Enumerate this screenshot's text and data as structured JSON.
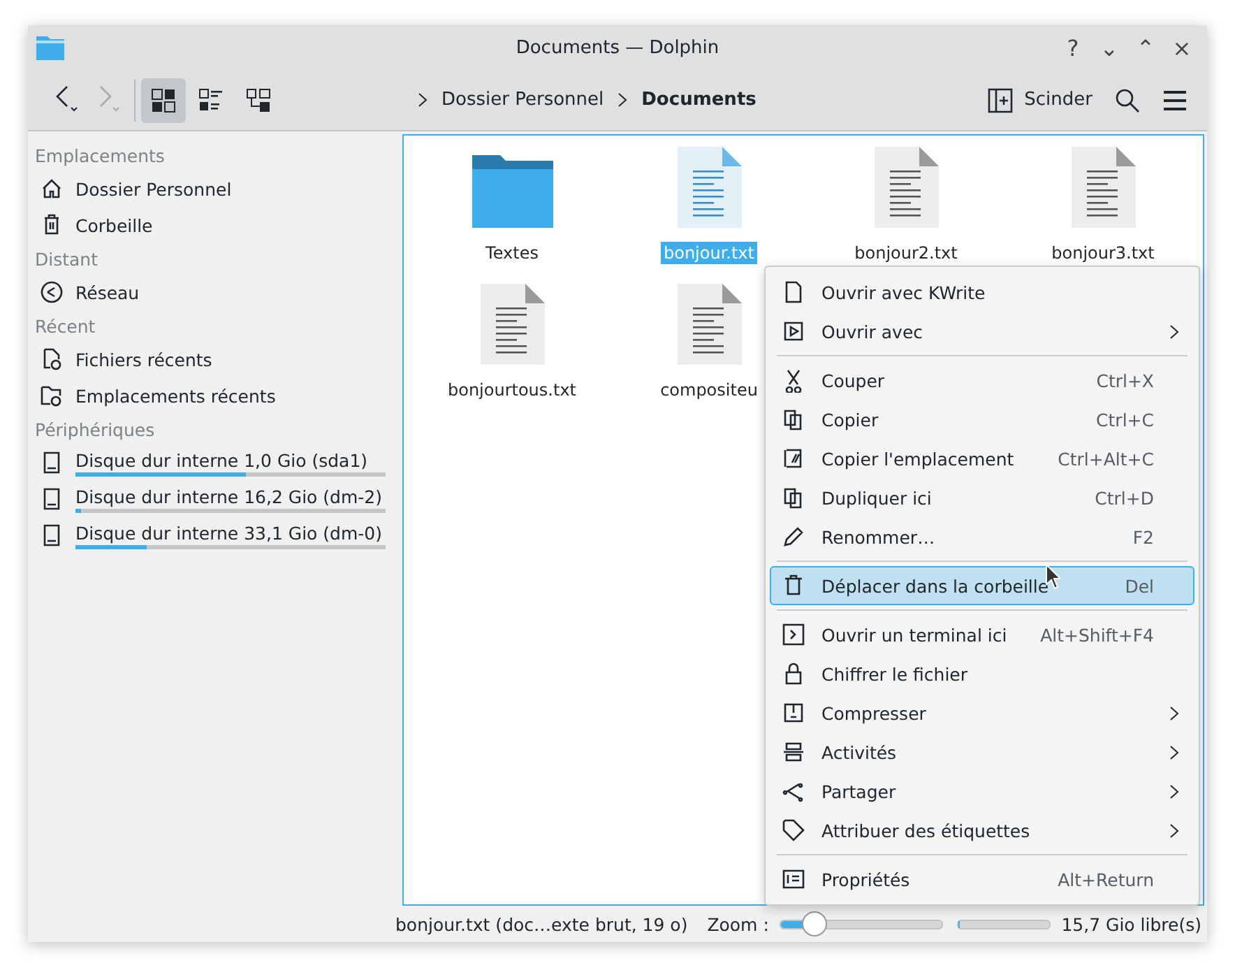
{
  "window": {
    "title": "Documents — Dolphin",
    "buttons": [
      "?",
      "⌄",
      "⌃",
      "×"
    ]
  },
  "toolbar": {
    "nav": [
      {
        "disabled": false
      },
      {
        "disabled": true
      }
    ],
    "views": [
      {
        "selected": true
      },
      {
        "selected": false
      },
      {
        "selected": false
      }
    ],
    "breadcrumb": [
      {
        "label": "Dossier Personnel",
        "current": false
      },
      {
        "label": "Documents",
        "current": true
      }
    ],
    "split_label": "Scinder"
  },
  "sidebar": [
    {
      "heading": "Emplacements",
      "items": [
        {
          "label": "Dossier Personnel"
        },
        {
          "label": "Corbeille"
        }
      ]
    },
    {
      "heading": "Distant",
      "items": [
        {
          "label": "Réseau"
        }
      ]
    },
    {
      "heading": "Récent",
      "items": [
        {
          "label": "Fichiers récents"
        },
        {
          "label": "Emplacements récents"
        }
      ]
    },
    {
      "heading": "Périphériques",
      "items": [
        {
          "label": "Disque dur interne 1,0 Gio (sda1)",
          "level": 0.55
        },
        {
          "label": "Disque dur interne 16,2 Gio (dm-2)",
          "level": 0.02
        },
        {
          "label": "Disque dur interne 33,1 Gio (dm-0)",
          "level": 0.23
        }
      ]
    }
  ],
  "files": [
    {
      "name": "Textes",
      "kind": "folder",
      "selected": false
    },
    {
      "name": "bonjour.txt",
      "kind": "text",
      "selected": true
    },
    {
      "name": "bonjour2.txt",
      "kind": "text",
      "selected": false
    },
    {
      "name": "bonjour3.txt",
      "kind": "text",
      "selected": false
    },
    {
      "name": "bonjourtous.txt",
      "kind": "text",
      "selected": false
    },
    {
      "name": "compositeu",
      "kind": "text",
      "selected": false
    }
  ],
  "context_menu": [
    {
      "kind": "item",
      "label": "Ouvrir avec KWrite",
      "selected": false
    },
    {
      "kind": "item",
      "label": "Ouvrir avec",
      "submenu": true,
      "selected": false
    },
    {
      "kind": "separator"
    },
    {
      "kind": "item",
      "label": "Couper",
      "shortcut": "Ctrl+X",
      "selected": false
    },
    {
      "kind": "item",
      "label": "Copier",
      "shortcut": "Ctrl+C",
      "selected": false
    },
    {
      "kind": "item",
      "label": "Copier l'emplacement",
      "shortcut": "Ctrl+Alt+C",
      "selected": false
    },
    {
      "kind": "item",
      "label": "Dupliquer ici",
      "shortcut": "Ctrl+D",
      "selected": false
    },
    {
      "kind": "item",
      "label": "Renommer…",
      "shortcut": "F2",
      "selected": false
    },
    {
      "kind": "separator"
    },
    {
      "kind": "item",
      "label": "Déplacer dans la corbeille",
      "shortcut": "Del",
      "selected": true
    },
    {
      "kind": "separator"
    },
    {
      "kind": "item",
      "label": "Ouvrir un terminal ici",
      "shortcut": "Alt+Shift+F4",
      "selected": false
    },
    {
      "kind": "item",
      "label": "Chiffrer le fichier",
      "selected": false
    },
    {
      "kind": "item",
      "label": "Compresser",
      "submenu": true,
      "selected": false
    },
    {
      "kind": "item",
      "label": "Activités",
      "submenu": true,
      "selected": false
    },
    {
      "kind": "item",
      "label": "Partager",
      "submenu": true,
      "selected": false
    },
    {
      "kind": "item",
      "label": "Attribuer des étiquettes",
      "submenu": true,
      "selected": false
    },
    {
      "kind": "separator"
    },
    {
      "kind": "item",
      "label": "Propriétés",
      "shortcut": "Alt+Return",
      "selected": false
    }
  ],
  "status_bar": {
    "text": "bonjour.txt (doc…exte brut, 19 o)",
    "zoom_label": "Zoom :",
    "zoom": {
      "level": 0.2
    },
    "space": {
      "level": 0.01
    },
    "free": "15,7 Gio libre(s)"
  }
}
